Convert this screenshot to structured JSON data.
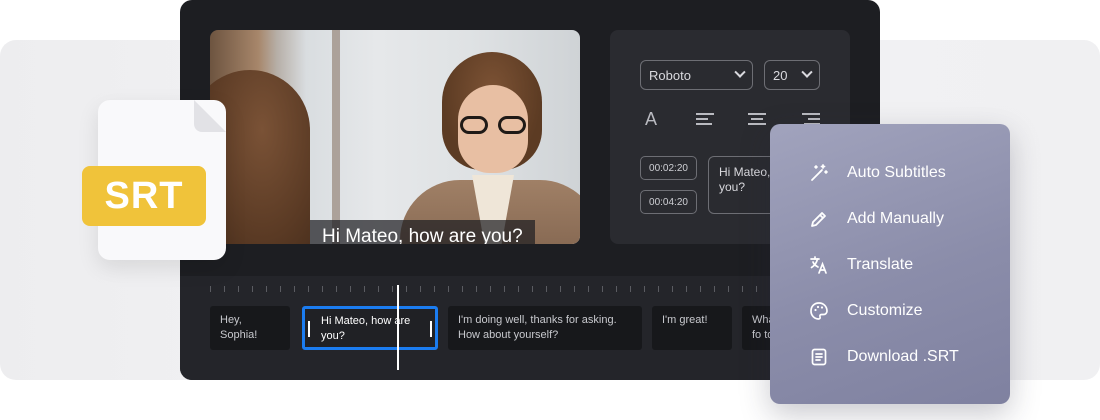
{
  "file_icon": {
    "badge": "SRT"
  },
  "video": {
    "caption": "Hi Mateo, how are you?"
  },
  "style_panel": {
    "font_value": "Roboto",
    "size_value": "20",
    "text_icon_glyph": "A",
    "cue_start": "00:02:20",
    "cue_end": "00:04:20",
    "cue_text": "Hi Mateo, how are you?"
  },
  "timeline": {
    "segments": [
      {
        "text": "Hey, Sophia!"
      },
      {
        "text": "Hi Mateo, how are you?"
      },
      {
        "text": "I'm doing well, thanks for asking. How about yourself?"
      },
      {
        "text": "I'm great!"
      },
      {
        "text": "What about fo to"
      }
    ],
    "selected_index": 1,
    "accent_color": "#1b7cf0"
  },
  "menu": {
    "items": [
      {
        "label": "Auto Subtitles",
        "icon": "magic-wand-icon"
      },
      {
        "label": "Add Manually",
        "icon": "pencil-icon"
      },
      {
        "label": "Translate",
        "icon": "translate-icon"
      },
      {
        "label": "Customize",
        "icon": "palette-icon"
      },
      {
        "label": "Download .SRT",
        "icon": "document-icon"
      }
    ]
  },
  "colors": {
    "badge": "#f0c33a",
    "editor_bg": "#1d1e22",
    "menu_bg": "#8b8daa"
  }
}
